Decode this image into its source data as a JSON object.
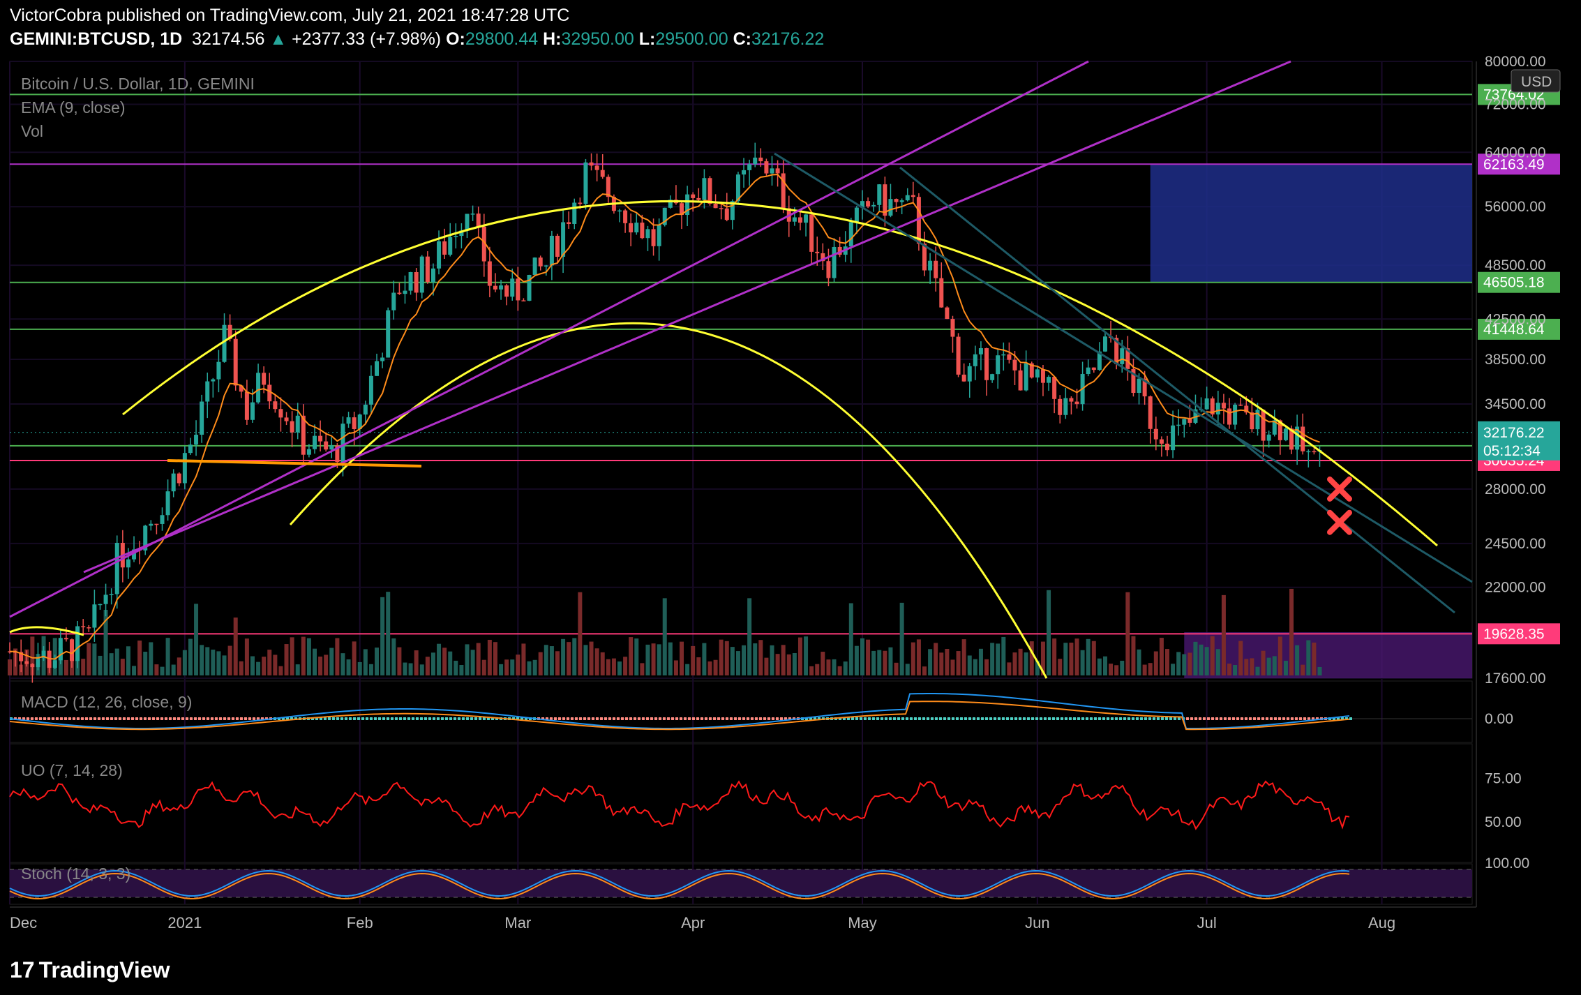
{
  "header": {
    "line1": "VictorCobra published on TradingView.com, July 21, 2021 18:47:28 UTC",
    "symbol": "GEMINI:BTCUSD, 1D",
    "last": "32174.56",
    "change": "+2377.33 (+7.98%)",
    "o_label": "O:",
    "o": "29800.44",
    "h_label": "H:",
    "h": "32950.00",
    "l_label": "L:",
    "l": "29500.00",
    "c_label": "C:",
    "c": "32176.22"
  },
  "panes": {
    "main_title": "Bitcoin / U.S. Dollar, 1D, GEMINI",
    "ema_label": "EMA (9, close)",
    "vol_label": "Vol",
    "macd_label": "MACD (12, 26, close, 9)",
    "uo_label": "UO (7, 14, 28)",
    "stoch_label": "Stoch (14, 3, 3)",
    "currency": "USD"
  },
  "colors": {
    "up": "#26a69a",
    "down": "#ef5350",
    "ema": "#ff8c1a",
    "arc": "#ffff33",
    "channel": "#b030c8",
    "green_level": "#4caf50",
    "pink_level": "#ff3b7a",
    "blue_zone": "#1e2e8a",
    "uo": "#ff1a1a"
  },
  "chart_data": {
    "type": "candlestick",
    "title": "Bitcoin / U.S. Dollar, 1D, GEMINI",
    "y_scale": "log",
    "ylim": [
      17600,
      80000
    ],
    "y_ticks": [
      80000,
      72000,
      64000,
      56000,
      48500,
      42500,
      38500,
      34500,
      28000,
      24500,
      22000,
      17600
    ],
    "x_ticks": [
      "Dec",
      "2021",
      "Feb",
      "Mar",
      "Apr",
      "May",
      "Jun",
      "Jul",
      "Aug"
    ],
    "x_range": [
      "2020-12-01",
      "2021-08-17"
    ],
    "price_levels": [
      {
        "label": "73764.02",
        "value": 73764.02,
        "color": "#4caf50"
      },
      {
        "label": "62163.49",
        "value": 62163.49,
        "color": "#b030c8"
      },
      {
        "label": "46505.18",
        "value": 46505.18,
        "color": "#4caf50"
      },
      {
        "label": "41448.64",
        "value": 41448.64,
        "color": "#4caf50"
      },
      {
        "label": "31138.29",
        "value": 31138.29,
        "color": "#4caf50"
      },
      {
        "label": "30035.24",
        "value": 30035.24,
        "color": "#ff3b7a"
      },
      {
        "label": "19628.35",
        "value": 19628.35,
        "color": "#ff3b7a"
      }
    ],
    "last_price": {
      "label": "32176.22",
      "countdown": "05:12:34"
    },
    "close_series": [
      [
        "2020-12-01",
        18800
      ],
      [
        "2020-12-08",
        18500
      ],
      [
        "2020-12-15",
        19500
      ],
      [
        "2020-12-20",
        23500
      ],
      [
        "2020-12-27",
        26500
      ],
      [
        "2021-01-03",
        32000
      ],
      [
        "2021-01-08",
        40500
      ],
      [
        "2021-01-12",
        34000
      ],
      [
        "2021-01-15",
        37000
      ],
      [
        "2021-01-22",
        31500
      ],
      [
        "2021-01-27",
        30500
      ],
      [
        "2021-02-01",
        33500
      ],
      [
        "2021-02-08",
        46000
      ],
      [
        "2021-02-14",
        48500
      ],
      [
        "2021-02-21",
        57500
      ],
      [
        "2021-02-23",
        47000
      ],
      [
        "2021-02-28",
        45000
      ],
      [
        "2021-03-06",
        48500
      ],
      [
        "2021-03-13",
        61000
      ],
      [
        "2021-03-17",
        58000
      ],
      [
        "2021-03-25",
        51500
      ],
      [
        "2021-04-01",
        59000
      ],
      [
        "2021-04-07",
        56000
      ],
      [
        "2021-04-13",
        63500
      ],
      [
        "2021-04-18",
        56000
      ],
      [
        "2021-04-25",
        49000
      ],
      [
        "2021-05-03",
        57000
      ],
      [
        "2021-05-10",
        55500
      ],
      [
        "2021-05-12",
        49500
      ],
      [
        "2021-05-19",
        37000
      ],
      [
        "2021-05-24",
        38500
      ],
      [
        "2021-05-31",
        36500
      ],
      [
        "2021-06-07",
        34000
      ],
      [
        "2021-06-14",
        40500
      ],
      [
        "2021-06-22",
        32500
      ],
      [
        "2021-06-26",
        32000
      ],
      [
        "2021-07-02",
        34500
      ],
      [
        "2021-07-08",
        33000
      ],
      [
        "2021-07-14",
        32800
      ],
      [
        "2021-07-20",
        29800
      ],
      [
        "2021-07-21",
        32176
      ]
    ],
    "ema_9": true,
    "annotations": [
      {
        "type": "arc",
        "label": "outer parabolic arc"
      },
      {
        "type": "arc",
        "label": "inner parabolic arc"
      },
      {
        "type": "channel",
        "label": "rising channel"
      },
      {
        "type": "channel",
        "label": "falling channel"
      },
      {
        "type": "marker",
        "shape": "x",
        "value": 28000
      },
      {
        "type": "marker",
        "shape": "x",
        "value": 25800
      },
      {
        "type": "zone",
        "from": 46505,
        "to": 62163
      }
    ],
    "indicators": {
      "macd": {
        "y_ticks": [
          "0.00"
        ]
      },
      "uo": {
        "y_ticks": [
          "75.00",
          "50.00"
        ],
        "last": 51
      },
      "stoch": {
        "y_ticks": [
          "100.00"
        ]
      }
    }
  },
  "footer": {
    "brand": "TradingView",
    "logo_glyph": "17"
  }
}
